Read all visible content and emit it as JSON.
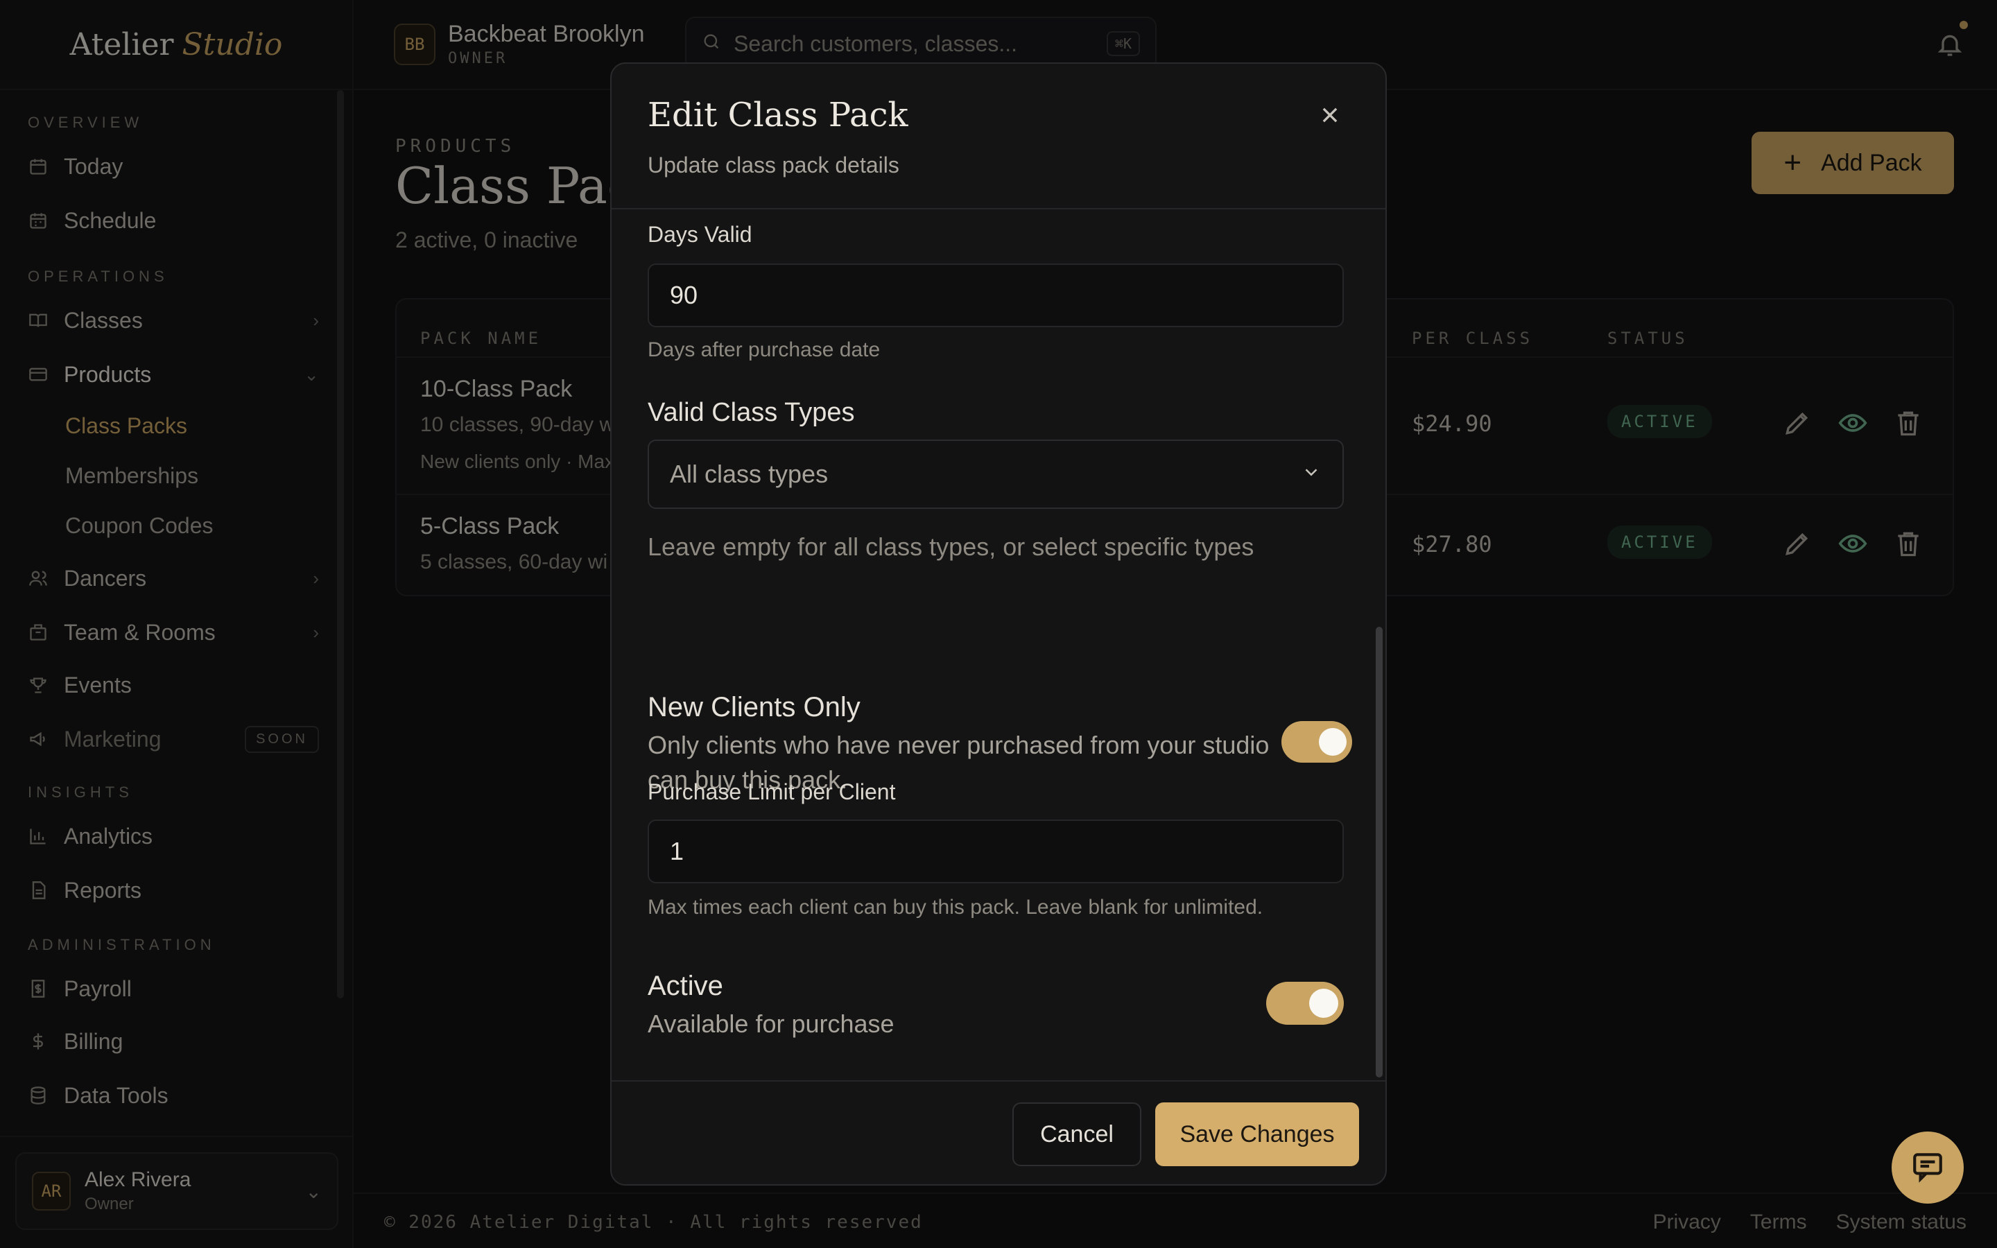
{
  "brand": {
    "name_1": "Atelier",
    "name_2": "Studio"
  },
  "header": {
    "studio_initials": "BB",
    "studio_name": "Backbeat Brooklyn",
    "studio_role": "OWNER",
    "search_placeholder": "Search customers, classes...",
    "search_shortcut": "⌘K"
  },
  "sidebar": {
    "sections": {
      "overview": "OVERVIEW",
      "operations": "OPERATIONS",
      "insights": "INSIGHTS",
      "administration": "ADMINISTRATION"
    },
    "items": {
      "today": "Today",
      "schedule": "Schedule",
      "classes": "Classes",
      "products": "Products",
      "class_packs": "Class Packs",
      "memberships": "Memberships",
      "coupon_codes": "Coupon Codes",
      "dancers": "Dancers",
      "team_rooms": "Team & Rooms",
      "events": "Events",
      "marketing": "Marketing",
      "marketing_badge": "SOON",
      "analytics": "Analytics",
      "reports": "Reports",
      "payroll": "Payroll",
      "billing": "Billing",
      "data_tools": "Data Tools"
    },
    "user": {
      "initials": "AR",
      "name": "Alex Rivera",
      "role": "Owner"
    }
  },
  "page": {
    "eyebrow": "PRODUCTS",
    "title": "Class Packs",
    "subtitle": "2 active, 0 inactive",
    "add_button": "Add Pack"
  },
  "table": {
    "headers": {
      "name": "PACK NAME",
      "per_class": "PER CLASS",
      "status": "STATUS"
    },
    "rows": [
      {
        "name": "10-Class Pack",
        "meta": "10 classes, 90-day w",
        "restrictions": "New clients only · Max",
        "per_class": "$24.90",
        "status": "ACTIVE"
      },
      {
        "name": "5-Class Pack",
        "meta": "5 classes, 60-day wi",
        "per_class": "$27.80",
        "status": "ACTIVE"
      }
    ]
  },
  "modal": {
    "title": "Edit Class Pack",
    "subtitle": "Update class pack details",
    "days_valid_label": "Days Valid",
    "days_valid_value": "90",
    "days_valid_hint": "Days after purchase date",
    "class_types_label": "Valid Class Types",
    "class_types_value": "All class types",
    "class_types_hint": "Leave empty for all class types, or select specific types",
    "new_clients_label": "New Clients Only",
    "new_clients_hint": "Only clients who have never purchased from your studio can buy this pack.",
    "new_clients_on": true,
    "purchase_limit_label": "Purchase Limit per Client",
    "purchase_limit_value": "1",
    "purchase_limit_hint": "Max times each client can buy this pack. Leave blank for unlimited.",
    "active_label": "Active",
    "active_hint": "Available for purchase",
    "active_on": true,
    "cancel": "Cancel",
    "save": "Save Changes"
  },
  "footer": {
    "copyright": "© 2026 Atelier Digital · All rights reserved",
    "links": [
      "Privacy",
      "Terms",
      "System status"
    ]
  },
  "colors": {
    "accent": "#c9a463",
    "success": "#6fae8a",
    "background": "#121213"
  }
}
